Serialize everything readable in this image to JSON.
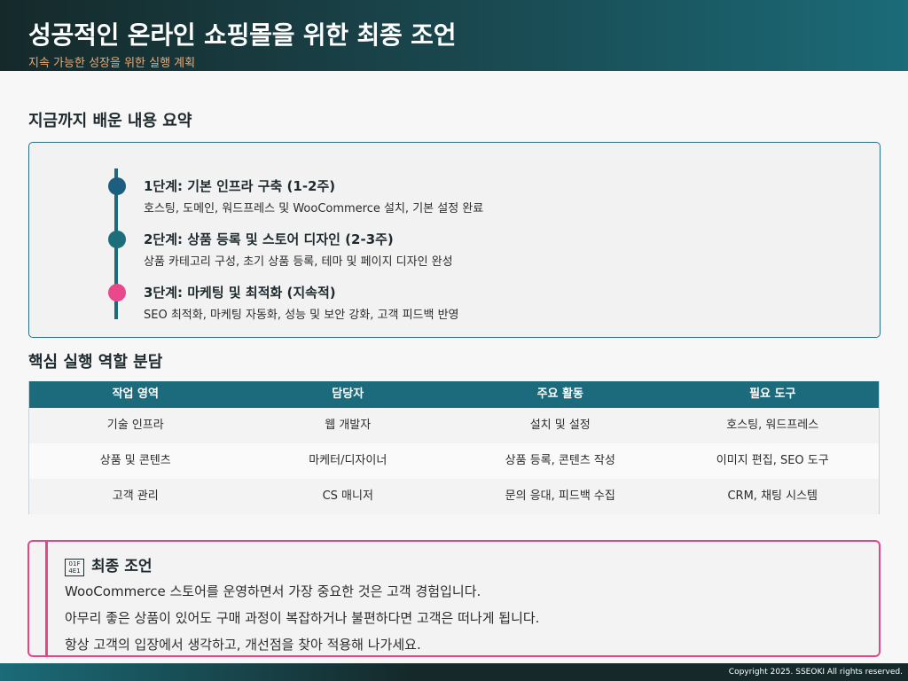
{
  "header": {
    "title": "성공적인 온라인 쇼핑몰을 위한 최종 조언",
    "subtitle": "지속 가능한 성장을 위한 실행 계획"
  },
  "summary": {
    "heading": "지금까지 배운 내용 요약",
    "steps": [
      {
        "title": "1단계: 기본 인프라 구축 (1-2주)",
        "desc": "호스팅, 도메인, 워드프레스 및 WooCommerce 설치, 기본 설정 완료",
        "color": "#1b5e80"
      },
      {
        "title": "2단계: 상품 등록 및 스토어 디자인 (2-3주)",
        "desc": "상품 카테고리 구성, 초기 상품 등록, 테마 및 페이지 디자인 완성",
        "color": "#1d6e7a"
      },
      {
        "title": "3단계: 마케팅 및 최적화 (지속적)",
        "desc": "SEO 최적화, 마케팅 자동화, 성능 및 보안 강화, 고객 피드백 반영",
        "color": "#e9488a"
      }
    ]
  },
  "roles": {
    "heading": "핵심 실행 역할 분담",
    "columns": [
      "작업 영역",
      "담당자",
      "주요 활동",
      "필요 도구"
    ],
    "rows": [
      [
        "기술 인프라",
        "웹 개발자",
        "설치 및 설정",
        "호스팅, 워드프레스"
      ],
      [
        "상품 및 콘텐츠",
        "마케터/디자이너",
        "상품 등록, 콘텐츠 작성",
        "이미지 편집, SEO 도구"
      ],
      [
        "고객 관리",
        "CS 매니저",
        "문의 응대, 피드백 수집",
        "CRM, 채팅 시스템"
      ]
    ]
  },
  "advice": {
    "icon": "01F4E1",
    "title": "최종 조언",
    "lines": [
      "WooCommerce 스토어를 운영하면서 가장 중요한 것은 고객 경험입니다.",
      "아무리 좋은 상품이 있어도 구매 과정이 복잡하거나 불편하다면 고객은 떠나게 됩니다.",
      "항상 고객의 입장에서 생각하고, 개선점을 찾아 적용해 나가세요."
    ]
  },
  "footer": {
    "copyright": "Copyright 2025. SSEOKI All rights reserved."
  }
}
